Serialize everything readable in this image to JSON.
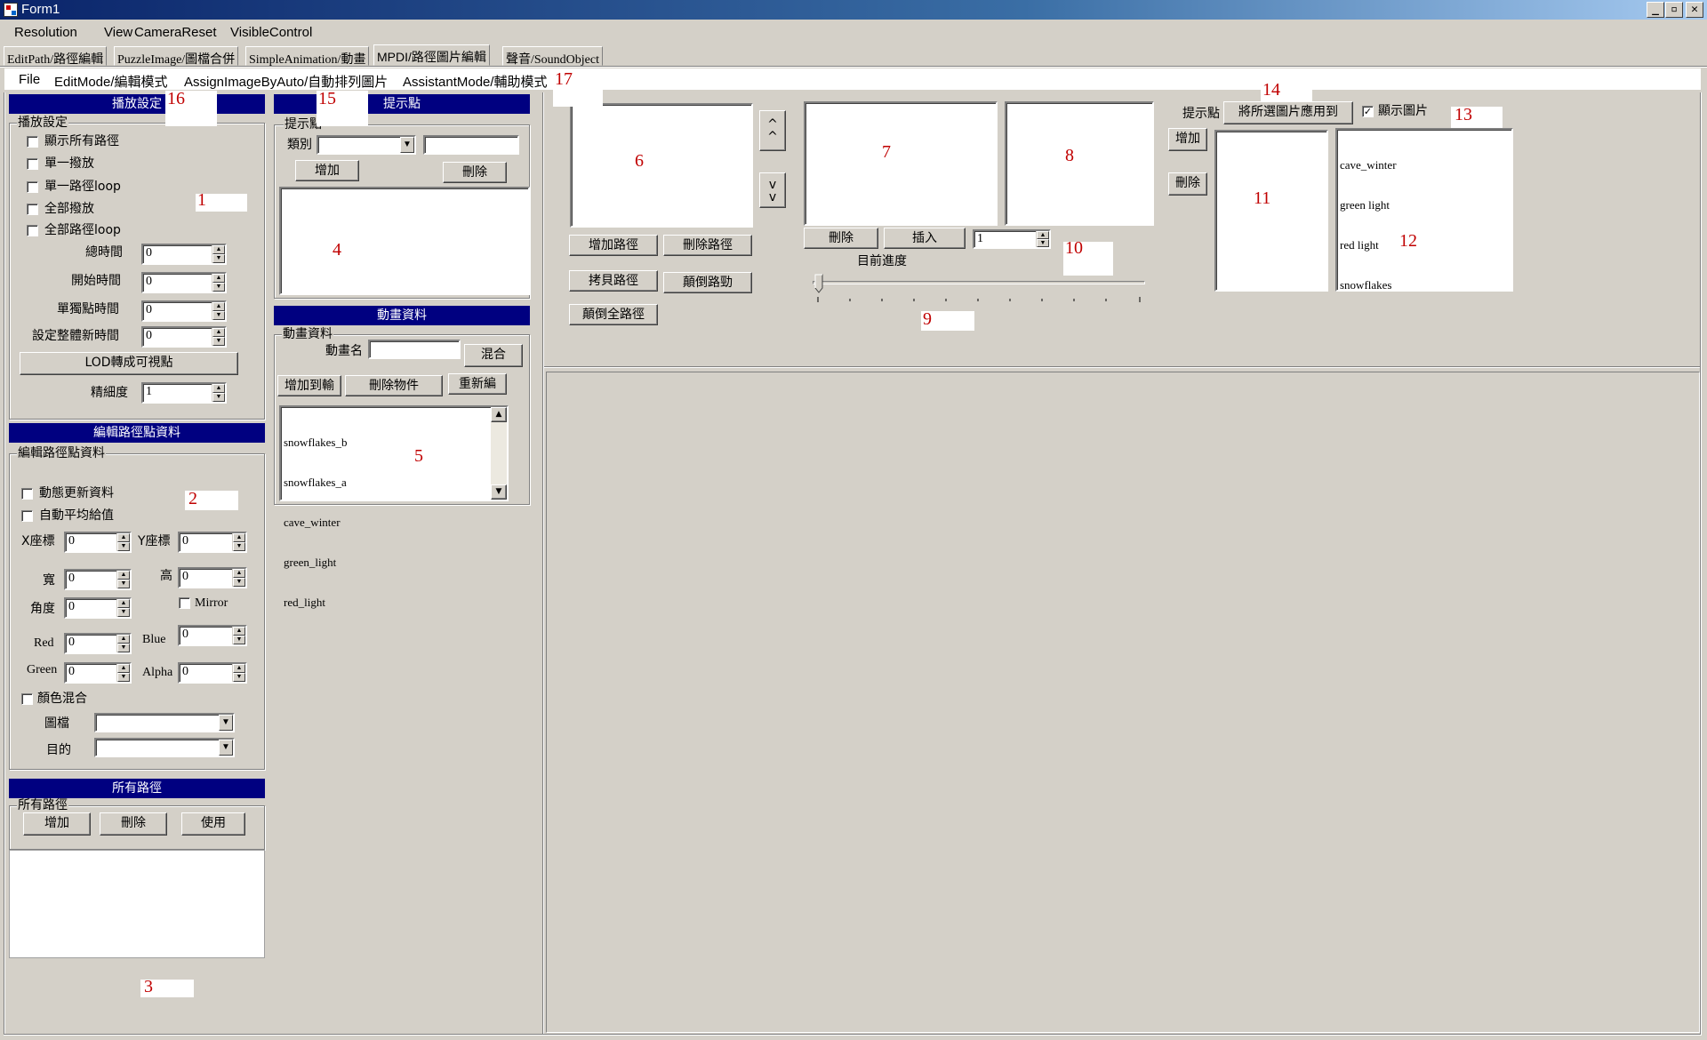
{
  "window": {
    "title": "Form1",
    "controls": [
      "_",
      "▫",
      "✕"
    ]
  },
  "menubar": [
    "Resolution",
    "View",
    "CameraReset",
    "VisibleControl"
  ],
  "tabs": [
    "EditPath/路徑編輯",
    "PuzzleImage/圖檔合併",
    "SimpleAnimation/動畫",
    "MPDI/路徑圖片編輯",
    "聲音/SoundObject"
  ],
  "submenu": [
    "File",
    "EditMode/編輯模式",
    "AssignImageByAuto/自動排列圖片",
    "AssistantMode/輔助模式"
  ],
  "play": {
    "header": "播放設定",
    "group": "播放設定",
    "checks": [
      "顯示所有路徑",
      "單一撥放",
      "單一路徑loop",
      "全部撥放",
      "全部路徑loop"
    ],
    "fields": [
      {
        "label": "總時間",
        "value": "0"
      },
      {
        "label": "開始時間",
        "value": "0"
      },
      {
        "label": "單獨點時間",
        "value": "0"
      },
      {
        "label": "設定整體新時間",
        "value": "0"
      }
    ],
    "lod_button": "LOD轉成可視點",
    "fine_label": "精細度",
    "fine_value": "1"
  },
  "edit": {
    "header": "編輯路徑點資料",
    "group": "編輯路徑點資料",
    "checks": [
      "動態更新資料",
      "自動平均給值"
    ],
    "x_label": "X座標",
    "x_value": "0",
    "y_label": "Y座標",
    "y_value": "0",
    "w_label": "寬",
    "w_value": "0",
    "h_label": "高",
    "h_value": "0",
    "angle_label": "角度",
    "angle_value": "0",
    "mirror_label": "Mirror",
    "red_label": "Red",
    "red_value": "0",
    "blue_label": "Blue",
    "blue_value": "0",
    "green_label": "Green",
    "green_value": "0",
    "alpha_label": "Alpha",
    "alpha_value": "0",
    "blend_label": "顏色混合",
    "image_label": "圖檔",
    "dest_label": "目的"
  },
  "paths": {
    "header": "所有路徑",
    "group": "所有路徑",
    "add": "增加",
    "delete": "刪除",
    "use": "使用"
  },
  "hint": {
    "header": "提示點",
    "group": "提示點",
    "category_label": "類別",
    "add": "增加",
    "delete": "刪除"
  },
  "anim": {
    "header": "動畫資料",
    "group": "動畫資料",
    "name_label": "動畫名",
    "blend_button": "混合",
    "add_button": "增加到輸",
    "del_button": "刪除物件",
    "reedit_button": "重新編",
    "list": [
      "snowflakes_b",
      "snowflakes_a",
      "cave_winter",
      "green_light",
      "red_light"
    ]
  },
  "top": {
    "up": "^\n^",
    "down": "v\nv",
    "add_path": "增加路徑",
    "del_path": "刪除路徑",
    "copy_path": "拷貝路徑",
    "reverse_path": "顛倒路勁",
    "reverse_all": "顛倒全路徑",
    "delete": "刪除",
    "insert": "插入",
    "spin_value": "1",
    "progress_label": "目前進度",
    "progress_value": 0,
    "hint_label": "提示點",
    "apply_button": "將所選圖片應用到",
    "show_image": "顯示圖片",
    "add_small": "增加",
    "del_small": "刪除",
    "image_list": [
      "cave_winter",
      "green light",
      "red light",
      "snowflakes"
    ]
  },
  "callouts": [
    "1",
    "2",
    "3",
    "4",
    "5",
    "6",
    "7",
    "8",
    "9",
    "10",
    "11",
    "12",
    "13",
    "14",
    "15",
    "16",
    "17"
  ]
}
